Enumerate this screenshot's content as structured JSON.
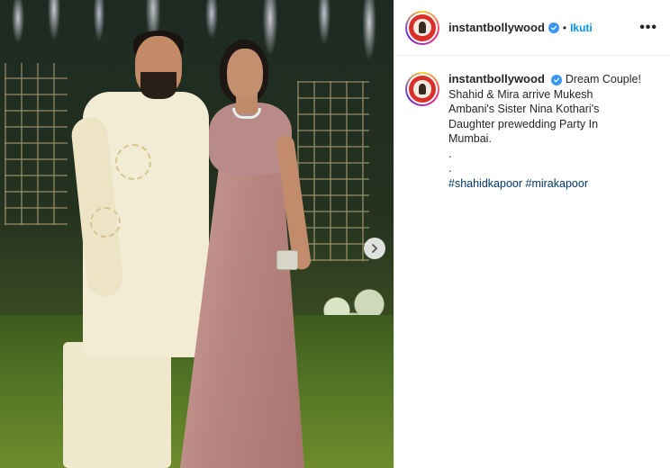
{
  "post": {
    "username": "instantbollywood",
    "follow_label": "Ikuti",
    "separator": "•",
    "more_label": "•••",
    "caption": {
      "username": "instantbollywood",
      "first_line": "Dream Couple!",
      "lines": [
        "Shahid & Mira arrive Mukesh",
        "Ambani's Sister Nina Kothari's",
        "Daughter prewedding Party In",
        "Mumbai.",
        ".",
        "."
      ],
      "hashtags": [
        "#shahidkapoor",
        "#mirakapoor"
      ]
    }
  },
  "colors": {
    "link_blue": "#0095f6",
    "hashtag_blue": "#00376b",
    "verified_blue": "#3897f0"
  },
  "icons": {
    "verified": "verified-badge-icon",
    "next": "chevron-right-icon",
    "more": "more-options-icon"
  }
}
